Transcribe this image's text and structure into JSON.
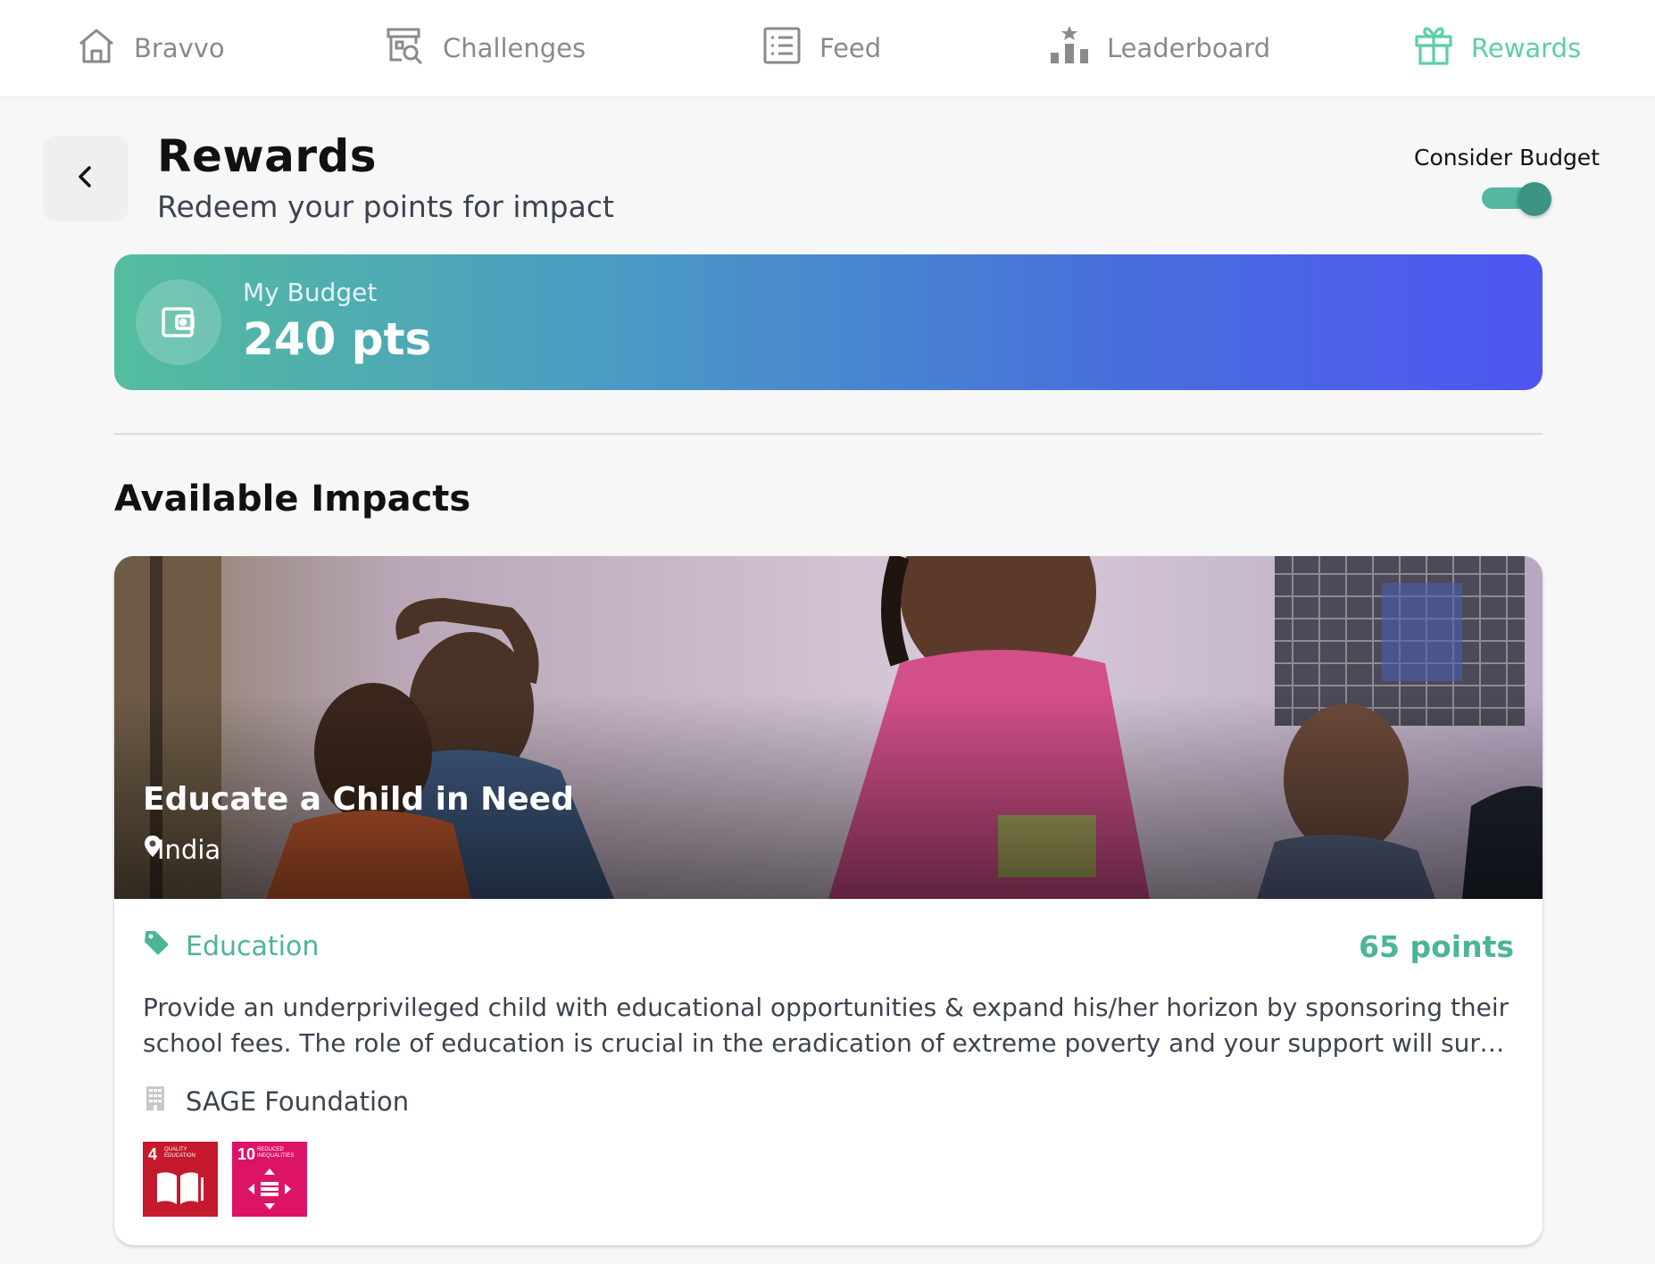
{
  "nav": {
    "items": [
      {
        "label": "Bravvo",
        "icon": "home-icon"
      },
      {
        "label": "Challenges",
        "icon": "challenges-icon"
      },
      {
        "label": "Feed",
        "icon": "feed-icon"
      },
      {
        "label": "Leaderboard",
        "icon": "leaderboard-icon"
      },
      {
        "label": "Rewards",
        "icon": "gift-icon",
        "active": true
      }
    ]
  },
  "colors": {
    "accent": "#5ccfa6",
    "accent_text": "#4bb59a",
    "nav_inactive": "#8a8a8a",
    "gradient_start": "#54bd9e",
    "gradient_end": "#4f55f2",
    "sdg4": "#c5192d",
    "sdg10": "#dd1367"
  },
  "header": {
    "title": "Rewards",
    "subtitle": "Redeem your points for impact",
    "back_icon": "chevron-left-icon"
  },
  "budget_toggle": {
    "label": "Consider Budget",
    "on": true
  },
  "budget": {
    "label": "My Budget",
    "value": "240 pts",
    "icon": "wallet-icon"
  },
  "impacts": {
    "section_title": "Available Impacts",
    "items": [
      {
        "title": "Educate a Child in Need",
        "location": "India",
        "category": "Education",
        "points": "65 points",
        "description": "Provide an underprivileged child with educational opportunities & expand his/her horizon by sponsoring their school fees. The role of education is crucial in the eradication of extreme poverty and your support will surely make a difference in their lives.",
        "organization": "SAGE Foundation",
        "sdgs": [
          {
            "number": "4",
            "text": "Quality Education"
          },
          {
            "number": "10",
            "text": "Reduced Inequalities"
          }
        ]
      }
    ]
  }
}
